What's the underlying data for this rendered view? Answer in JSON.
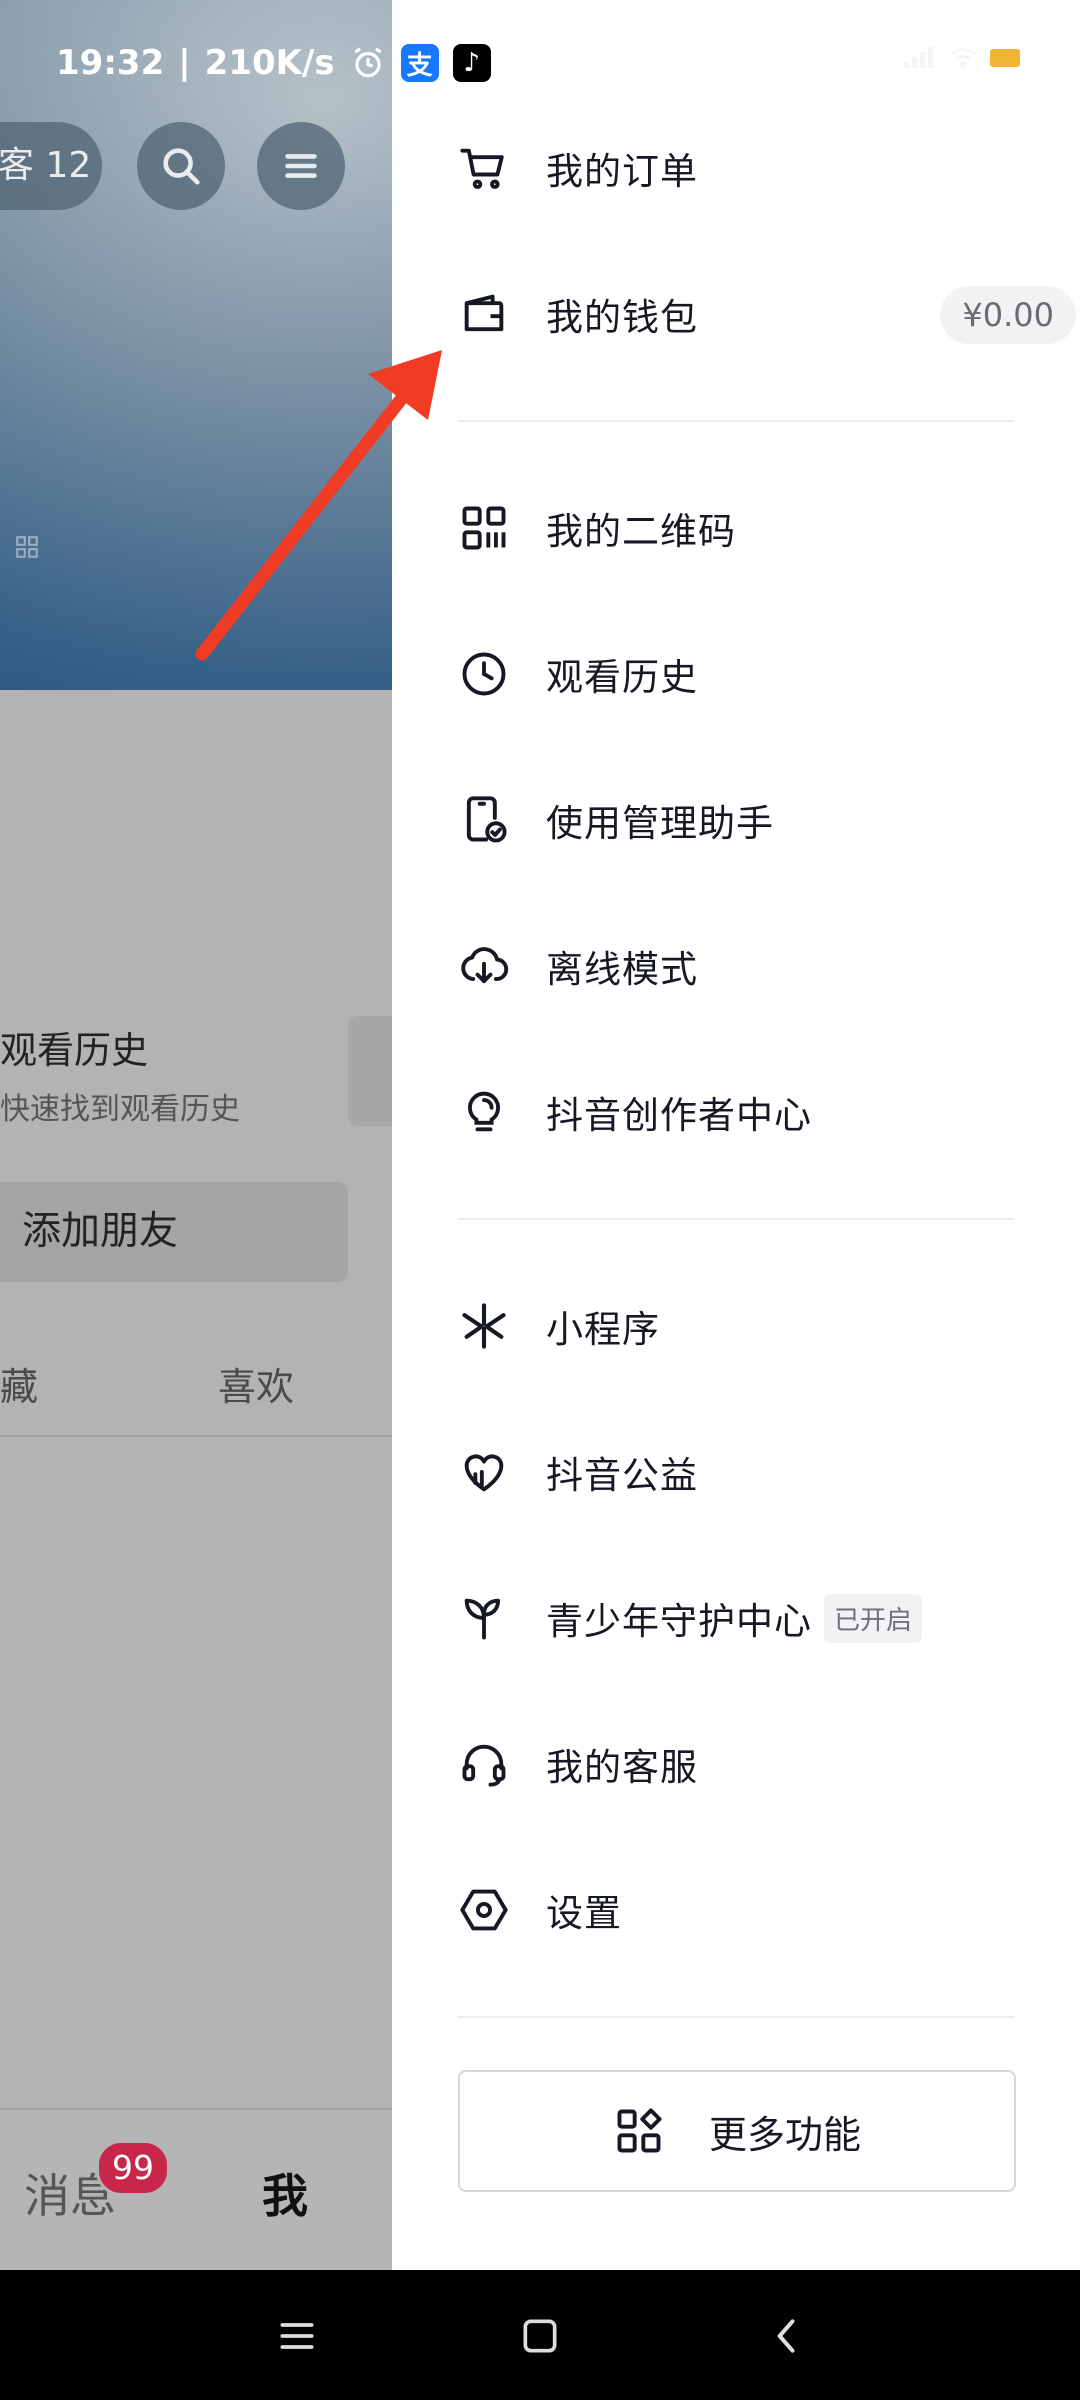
{
  "status_bar": {
    "time": "19:32",
    "separator": "|",
    "speed": "210K/s",
    "icons": [
      "alarm-icon",
      "alipay-icon",
      "tiktok-icon",
      "signal-icon",
      "wifi-icon",
      "battery-icon"
    ],
    "alipay_glyph": "支",
    "tiktok_glyph": "♪"
  },
  "background_app": {
    "visitor_pill": "客 12",
    "history_title": "观看历史",
    "history_subtitle": "快速找到观看历史",
    "add_friend": "添加朋友",
    "tab_collect": "藏",
    "tab_like": "喜欢",
    "nav_messages": "消息",
    "nav_messages_badge": "99",
    "nav_me": "我"
  },
  "drawer": {
    "items": [
      {
        "label": "我的订单",
        "icon": "cart-icon"
      },
      {
        "label": "我的钱包",
        "icon": "wallet-icon",
        "balance": "¥0.00"
      },
      {
        "label": "我的二维码",
        "icon": "qr-code-icon"
      },
      {
        "label": "观看历史",
        "icon": "clock-icon"
      },
      {
        "label": "使用管理助手",
        "icon": "phone-check-icon"
      },
      {
        "label": "离线模式",
        "icon": "cloud-download-icon"
      },
      {
        "label": "抖音创作者中心",
        "icon": "lightbulb-icon"
      },
      {
        "label": "小程序",
        "icon": "mini-program-icon"
      },
      {
        "label": "抖音公益",
        "icon": "charity-heart-icon"
      },
      {
        "label": "青少年守护中心",
        "icon": "sprout-icon",
        "tag": "已开启"
      },
      {
        "label": "我的客服",
        "icon": "headset-icon"
      },
      {
        "label": "设置",
        "icon": "settings-hex-icon"
      }
    ],
    "more_button": "更多功能"
  },
  "colors": {
    "accent_arrow": "#f03c24",
    "badge": "#c8264a",
    "text_primary": "#161823"
  }
}
